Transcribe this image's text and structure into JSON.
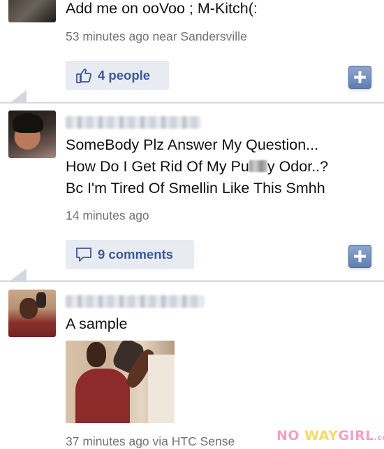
{
  "posts": [
    {
      "text_lines": [
        "Add me on ooVoo ; M-Kitch(:"
      ],
      "meta": "53 minutes ago near Sandersville",
      "action": {
        "type": "like",
        "label": "4 people"
      }
    },
    {
      "text_lines": [
        "SomeBody Plz Answer My Question...",
        "How Do I Get Rid Of My Pu",
        "y Odor..?",
        "Bc I'm Tired Of Smellin Like This Smhh"
      ],
      "meta": "14 minutes ago",
      "action": {
        "type": "comment",
        "label": "9 comments"
      }
    },
    {
      "text_lines": [
        "A sample"
      ],
      "meta": "37 minutes ago via HTC Sense"
    }
  ],
  "watermark": {
    "part1": "NO ",
    "part2": "WAY",
    "part3": "GIRL",
    "part4": ".com"
  },
  "colors": {
    "accent": "#3b5998",
    "meta": "#6f7379",
    "divider": "#d4d7de",
    "button_bg": "#e8ebf1"
  }
}
